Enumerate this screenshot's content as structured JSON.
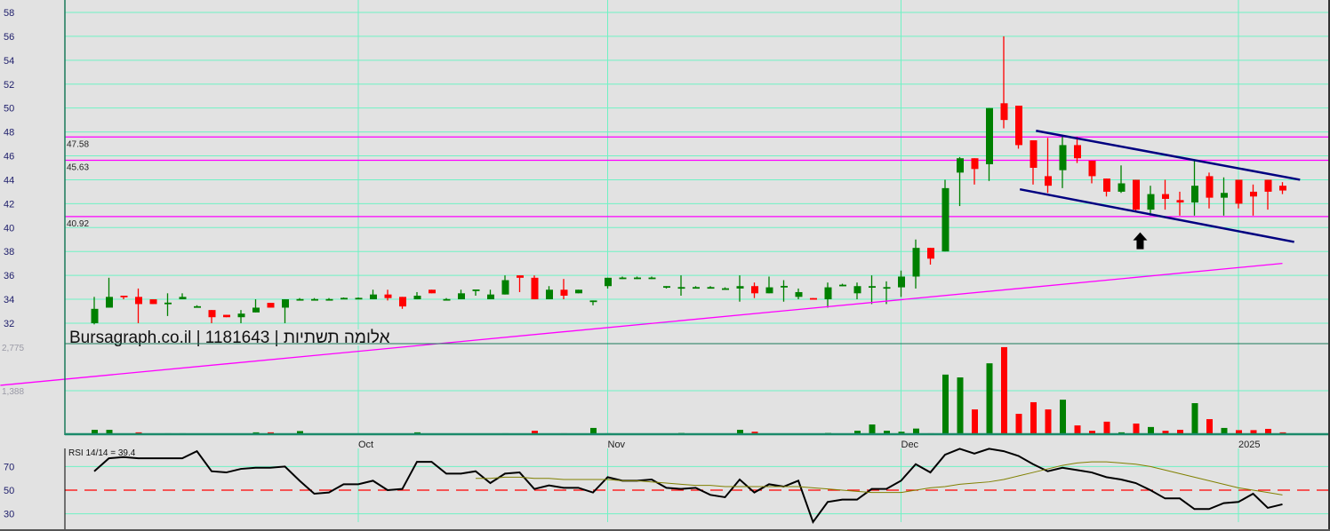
{
  "watermark": "Bursagraph.co.il | 1181643 | אלומה תשתיות",
  "colors": {
    "up": "#008000",
    "down": "#ff0000",
    "grid": "#6ff2c4",
    "level": "#ff00ff",
    "trend": "#000080",
    "rsi": "#000000",
    "rsi_ma": "#808000",
    "rsi_mid": "#ff0000"
  },
  "chart_data": {
    "type": "candlestick",
    "title": "Bursagraph.co.il | 1181643 | אלומה תשתיות",
    "price_axis": {
      "ylim": [
        32,
        58
      ],
      "ticks": [
        "32",
        "34",
        "36",
        "38",
        "40",
        "42",
        "44",
        "46",
        "48",
        "50",
        "52",
        "54",
        "56",
        "58"
      ]
    },
    "x_labels": [
      {
        "label": "Oct",
        "index": 18
      },
      {
        "label": "Nov",
        "index": 35
      },
      {
        "label": "Dec",
        "index": 55
      },
      {
        "label": "2025",
        "index": 78
      }
    ],
    "levels": [
      {
        "value": 47.58,
        "label": "47.58"
      },
      {
        "value": 45.63,
        "label": "45.63"
      },
      {
        "value": 40.92,
        "label": "40.92"
      }
    ],
    "trendlines": [
      {
        "name": "channel-upper",
        "from": [
          64.2,
          48.1
        ],
        "to": [
          82.2,
          44.0
        ],
        "color": "#000080"
      },
      {
        "name": "channel-lower",
        "from": [
          63.1,
          43.2
        ],
        "to": [
          81.8,
          38.8
        ],
        "color": "#000080"
      },
      {
        "name": "support-diagonal",
        "from": [
          -6.4,
          26.8
        ],
        "to": [
          81,
          37.0
        ],
        "color": "#ff00ff"
      }
    ],
    "arrow": {
      "index": 71.3,
      "price": 39.6,
      "direction": "up"
    },
    "ohlc": [
      [
        32.0,
        34.2,
        31.9,
        33.2
      ],
      [
        33.3,
        35.8,
        33.3,
        34.2
      ],
      [
        34.3,
        34.3,
        34.0,
        34.2
      ],
      [
        34.2,
        34.9,
        32.0,
        33.6
      ],
      [
        34.0,
        34.0,
        33.6,
        33.6
      ],
      [
        33.7,
        34.5,
        32.6,
        33.72
      ],
      [
        34.0,
        34.5,
        34.0,
        34.2
      ],
      [
        33.4,
        33.5,
        33.3,
        33.42
      ],
      [
        33.1,
        33.1,
        32.0,
        32.5
      ],
      [
        32.7,
        32.7,
        32.5,
        32.5
      ],
      [
        32.5,
        33.1,
        32.0,
        32.8
      ],
      [
        32.9,
        34.0,
        32.9,
        33.3
      ],
      [
        33.7,
        33.7,
        33.3,
        33.3
      ],
      [
        33.3,
        34.0,
        32.0,
        34.0
      ],
      [
        34.0,
        34.1,
        33.9,
        34.02
      ],
      [
        34.0,
        34.1,
        33.9,
        34.02
      ],
      [
        34.0,
        34.1,
        33.9,
        34.02
      ],
      [
        34.1,
        34.15,
        34.05,
        34.12
      ],
      [
        34.1,
        34.15,
        34.05,
        34.12
      ],
      [
        34.0,
        34.8,
        34.0,
        34.4
      ],
      [
        34.4,
        34.8,
        33.9,
        34.1
      ],
      [
        34.2,
        34.2,
        33.2,
        33.4
      ],
      [
        34.0,
        34.6,
        34.0,
        34.3
      ],
      [
        34.8,
        34.8,
        34.5,
        34.5
      ],
      [
        34.0,
        34.1,
        33.9,
        34.02
      ],
      [
        34.0,
        34.8,
        34.0,
        34.5
      ],
      [
        34.8,
        34.82,
        34.3,
        34.82
      ],
      [
        34.0,
        34.8,
        34.0,
        34.4
      ],
      [
        34.4,
        36.0,
        34.4,
        35.6
      ],
      [
        36.0,
        36.0,
        34.6,
        35.8
      ],
      [
        35.8,
        36.0,
        34.0,
        34.0
      ],
      [
        34.0,
        35.1,
        34.0,
        34.8
      ],
      [
        34.8,
        35.7,
        34.0,
        34.3
      ],
      [
        34.5,
        34.8,
        34.5,
        34.8
      ],
      [
        33.9,
        33.9,
        33.5,
        33.9
      ],
      [
        35.1,
        35.8,
        34.9,
        35.8
      ],
      [
        35.8,
        35.9,
        35.7,
        35.82
      ],
      [
        35.8,
        35.9,
        35.7,
        35.82
      ],
      [
        35.8,
        35.9,
        35.7,
        35.82
      ],
      [
        35.1,
        35.1,
        34.9,
        35.1
      ],
      [
        35.0,
        36.0,
        34.3,
        35.02
      ],
      [
        35.0,
        35.1,
        34.9,
        35.02
      ],
      [
        35.0,
        35.1,
        34.9,
        35.02
      ],
      [
        34.9,
        35.0,
        34.8,
        34.92
      ],
      [
        34.9,
        36.0,
        33.8,
        35.1
      ],
      [
        35.1,
        35.4,
        34.1,
        34.5
      ],
      [
        34.5,
        35.9,
        34.5,
        35.0
      ],
      [
        35.1,
        35.6,
        33.8,
        35.12
      ],
      [
        34.2,
        34.9,
        34.0,
        34.6
      ],
      [
        34.1,
        34.1,
        34.0,
        34.0
      ],
      [
        34.0,
        35.4,
        33.3,
        35.0
      ],
      [
        35.2,
        35.3,
        35.1,
        35.22
      ],
      [
        34.5,
        35.4,
        34.0,
        35.1
      ],
      [
        35.1,
        36.0,
        33.6,
        35.1
      ],
      [
        35.0,
        35.5,
        33.6,
        35.02
      ],
      [
        35.0,
        36.4,
        34.2,
        35.9
      ],
      [
        35.9,
        39.0,
        34.9,
        38.3
      ],
      [
        38.3,
        38.3,
        36.9,
        37.4
      ],
      [
        38.0,
        44.0,
        38.0,
        43.3
      ],
      [
        44.6,
        45.9,
        41.8,
        45.8
      ],
      [
        45.8,
        45.8,
        43.6,
        44.9
      ],
      [
        45.3,
        50.0,
        43.9,
        50.0
      ],
      [
        50.4,
        56.0,
        48.3,
        49.0
      ],
      [
        50.2,
        50.2,
        46.6,
        46.9
      ],
      [
        47.3,
        47.3,
        43.6,
        45.0
      ],
      [
        44.3,
        47.5,
        42.9,
        43.5
      ],
      [
        44.8,
        47.6,
        43.3,
        46.9
      ],
      [
        46.9,
        47.6,
        45.4,
        45.8
      ],
      [
        45.6,
        45.6,
        43.7,
        44.3
      ],
      [
        44.1,
        44.1,
        42.6,
        43.0
      ],
      [
        43.0,
        45.2,
        42.9,
        43.7
      ],
      [
        44.0,
        44.0,
        41.3,
        41.5
      ],
      [
        41.5,
        43.5,
        41.0,
        42.8
      ],
      [
        42.8,
        44.0,
        41.5,
        42.4
      ],
      [
        42.3,
        43.0,
        41.0,
        42.1
      ],
      [
        42.1,
        45.7,
        41.0,
        43.5
      ],
      [
        44.3,
        44.6,
        41.6,
        42.5
      ],
      [
        42.5,
        44.2,
        41.0,
        42.9
      ],
      [
        44.0,
        44.0,
        41.6,
        42.0
      ],
      [
        43.0,
        43.6,
        41.0,
        42.6
      ],
      [
        44.0,
        44.0,
        41.5,
        43.0
      ],
      [
        43.5,
        43.8,
        42.8,
        43.1
      ]
    ],
    "volume_axis": {
      "ticks": [
        {
          "value": 2775,
          "label": "2,775"
        },
        {
          "value": 1388,
          "label": "1,388"
        }
      ]
    },
    "volume": [
      140,
      140,
      10,
      60,
      10,
      30,
      30,
      10,
      10,
      10,
      10,
      60,
      60,
      10,
      100,
      10,
      10,
      10,
      10,
      10,
      10,
      10,
      60,
      10,
      10,
      10,
      20,
      20,
      30,
      20,
      110,
      20,
      30,
      10,
      200,
      30,
      10,
      10,
      10,
      15,
      40,
      20,
      10,
      10,
      140,
      80,
      10,
      20,
      20,
      10,
      40,
      10,
      110,
      310,
      110,
      80,
      180,
      30,
      1900,
      1810,
      790,
      2260,
      2775,
      650,
      1020,
      790,
      1100,
      280,
      110,
      400,
      60,
      340,
      230,
      110,
      140,
      990,
      480,
      200,
      130,
      130,
      170,
      60
    ],
    "rsi": {
      "label": "RSI 14/14 = 39.4",
      "ticks": [
        "70",
        "50",
        "30"
      ],
      "values": [
        66,
        77,
        78,
        77,
        77,
        77,
        77,
        83,
        66,
        65,
        68,
        69,
        69,
        70,
        58,
        47,
        48,
        55,
        55,
        58,
        50,
        51,
        74,
        74,
        64,
        64,
        66,
        56,
        64,
        65,
        51,
        54,
        52,
        52,
        48,
        61,
        58,
        58,
        59,
        52,
        51,
        52,
        46,
        44,
        59,
        48,
        55,
        53,
        58,
        23,
        40,
        42,
        42,
        51,
        51,
        58,
        72,
        65,
        80,
        85,
        81,
        85,
        83,
        79,
        72,
        66,
        69,
        67,
        65,
        61,
        59,
        56,
        50,
        43,
        43,
        34,
        34,
        39,
        40,
        47,
        35,
        38
      ],
      "ma_start_index": 26,
      "ma_values": [
        60,
        60,
        61,
        61,
        60,
        60,
        59,
        59,
        59,
        59,
        58,
        58,
        57,
        56,
        55,
        54,
        54,
        53,
        53,
        53,
        53,
        53,
        53,
        52,
        51,
        50,
        49,
        48,
        48,
        48,
        50,
        52,
        53,
        55,
        56,
        57,
        59,
        62,
        65,
        68,
        71,
        73,
        74,
        74,
        73,
        72,
        70,
        67,
        64,
        61,
        58,
        55,
        52,
        50,
        48,
        46
      ]
    }
  }
}
